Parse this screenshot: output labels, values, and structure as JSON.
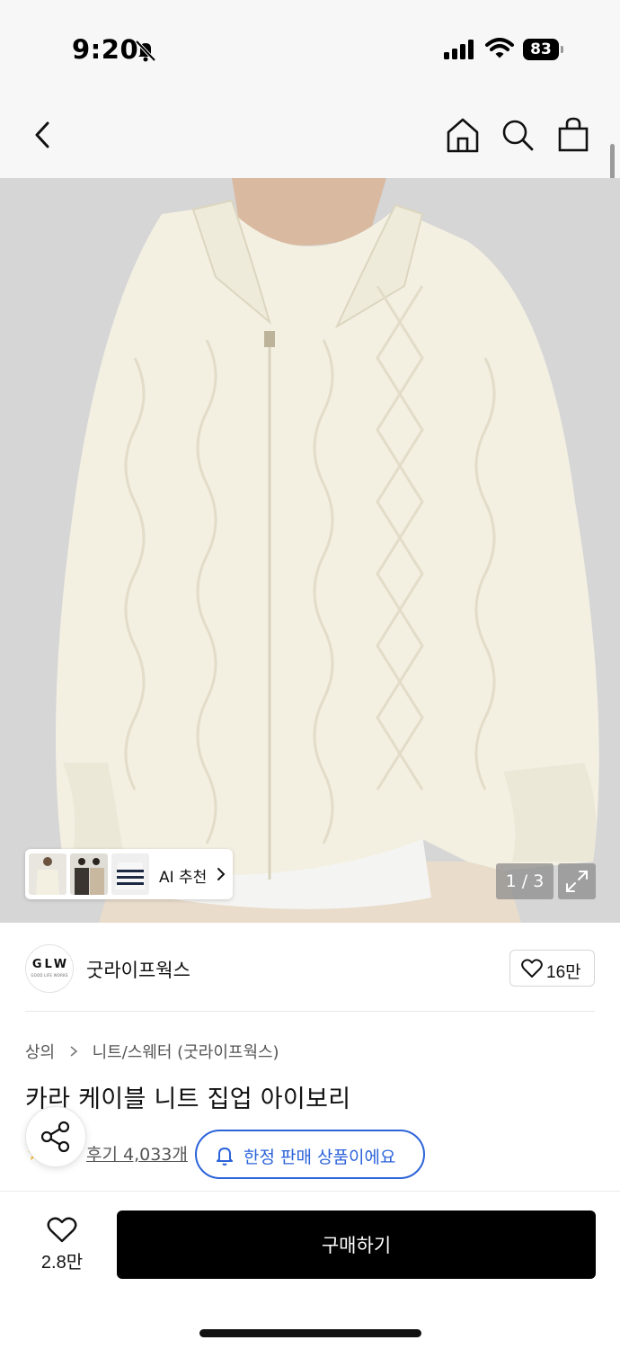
{
  "status_bar": {
    "time": "9:20",
    "battery": "83"
  },
  "product_image": {
    "page_counter": "1 / 3",
    "ai_chip_label": "AI 추천"
  },
  "brand": {
    "logo_text": "GLW",
    "logo_subtext": "GOOD LIFE WORKS",
    "name": "굿라이프웍스",
    "likes": "16만"
  },
  "breadcrumb": {
    "category": "상의",
    "subcategory": "니트/스웨터 (굿라이프웍스)"
  },
  "product": {
    "title": "카라 케이블 니트 집업 아이보리",
    "reviews": "후기 4,033개"
  },
  "limited_badge": "한정 판매 상품이에요",
  "bottom_bar": {
    "wish_count": "2.8만",
    "buy_label": "구매하기"
  },
  "colors": {
    "accent_blue": "#2b63d9",
    "buy_button": "#000000",
    "sweater_ivory": "#f3f0e2"
  },
  "icons": [
    "bell-off-icon",
    "signal-icon",
    "wifi-icon",
    "battery-icon",
    "back-icon",
    "home-icon",
    "search-icon",
    "bag-icon",
    "chevron-right-icon",
    "expand-icon",
    "heart-icon",
    "star-icon",
    "share-icon",
    "bell-icon"
  ]
}
